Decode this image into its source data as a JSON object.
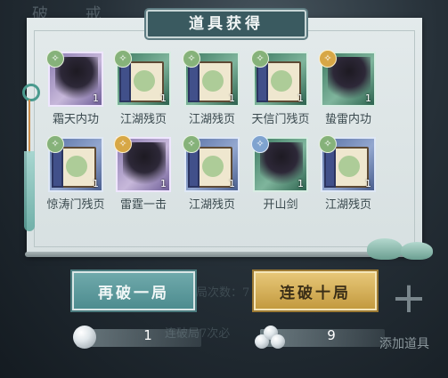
{
  "background": {
    "calligraphy": "破 戒"
  },
  "dialog": {
    "title": "道具获得"
  },
  "items": [
    {
      "name": "霜天内功",
      "qty": "1",
      "rarity": "purple",
      "badge": "green",
      "art": "figure-icon"
    },
    {
      "name": "江湖残页",
      "qty": "1",
      "rarity": "green",
      "badge": "green",
      "art": "book-icon"
    },
    {
      "name": "江湖残页",
      "qty": "1",
      "rarity": "green",
      "badge": "green",
      "art": "book-icon"
    },
    {
      "name": "天信门残页",
      "qty": "1",
      "rarity": "green",
      "badge": "green",
      "art": "book-icon"
    },
    {
      "name": "蛰雷内功",
      "qty": "1",
      "rarity": "green",
      "badge": "gold",
      "art": "figure-icon"
    },
    {
      "name": "惊涛门残页",
      "qty": "1",
      "rarity": "blue",
      "badge": "green",
      "art": "book-icon"
    },
    {
      "name": "雷霆一击",
      "qty": "1",
      "rarity": "purple",
      "badge": "gold",
      "art": "figure-icon"
    },
    {
      "name": "江湖残页",
      "qty": "1",
      "rarity": "blue",
      "badge": "green",
      "art": "book-icon"
    },
    {
      "name": "开山剑",
      "qty": "1",
      "rarity": "green",
      "badge": "blue",
      "art": "figure-icon"
    },
    {
      "name": "江湖残页",
      "qty": "1",
      "rarity": "blue",
      "badge": "green",
      "art": "book-icon"
    }
  ],
  "actions": {
    "once_label": "再破一局",
    "ten_label": "连破十局",
    "once_cost": "1",
    "ten_cost": "9",
    "add_label": "添加道具",
    "ghost_count_text": "局次数：7",
    "ghost_guarantee_text": "连破局7次必"
  },
  "colors": {
    "teal_button": "#5f9c9f",
    "gold_button": "#d4b15c",
    "banner": "#3a5a60"
  }
}
